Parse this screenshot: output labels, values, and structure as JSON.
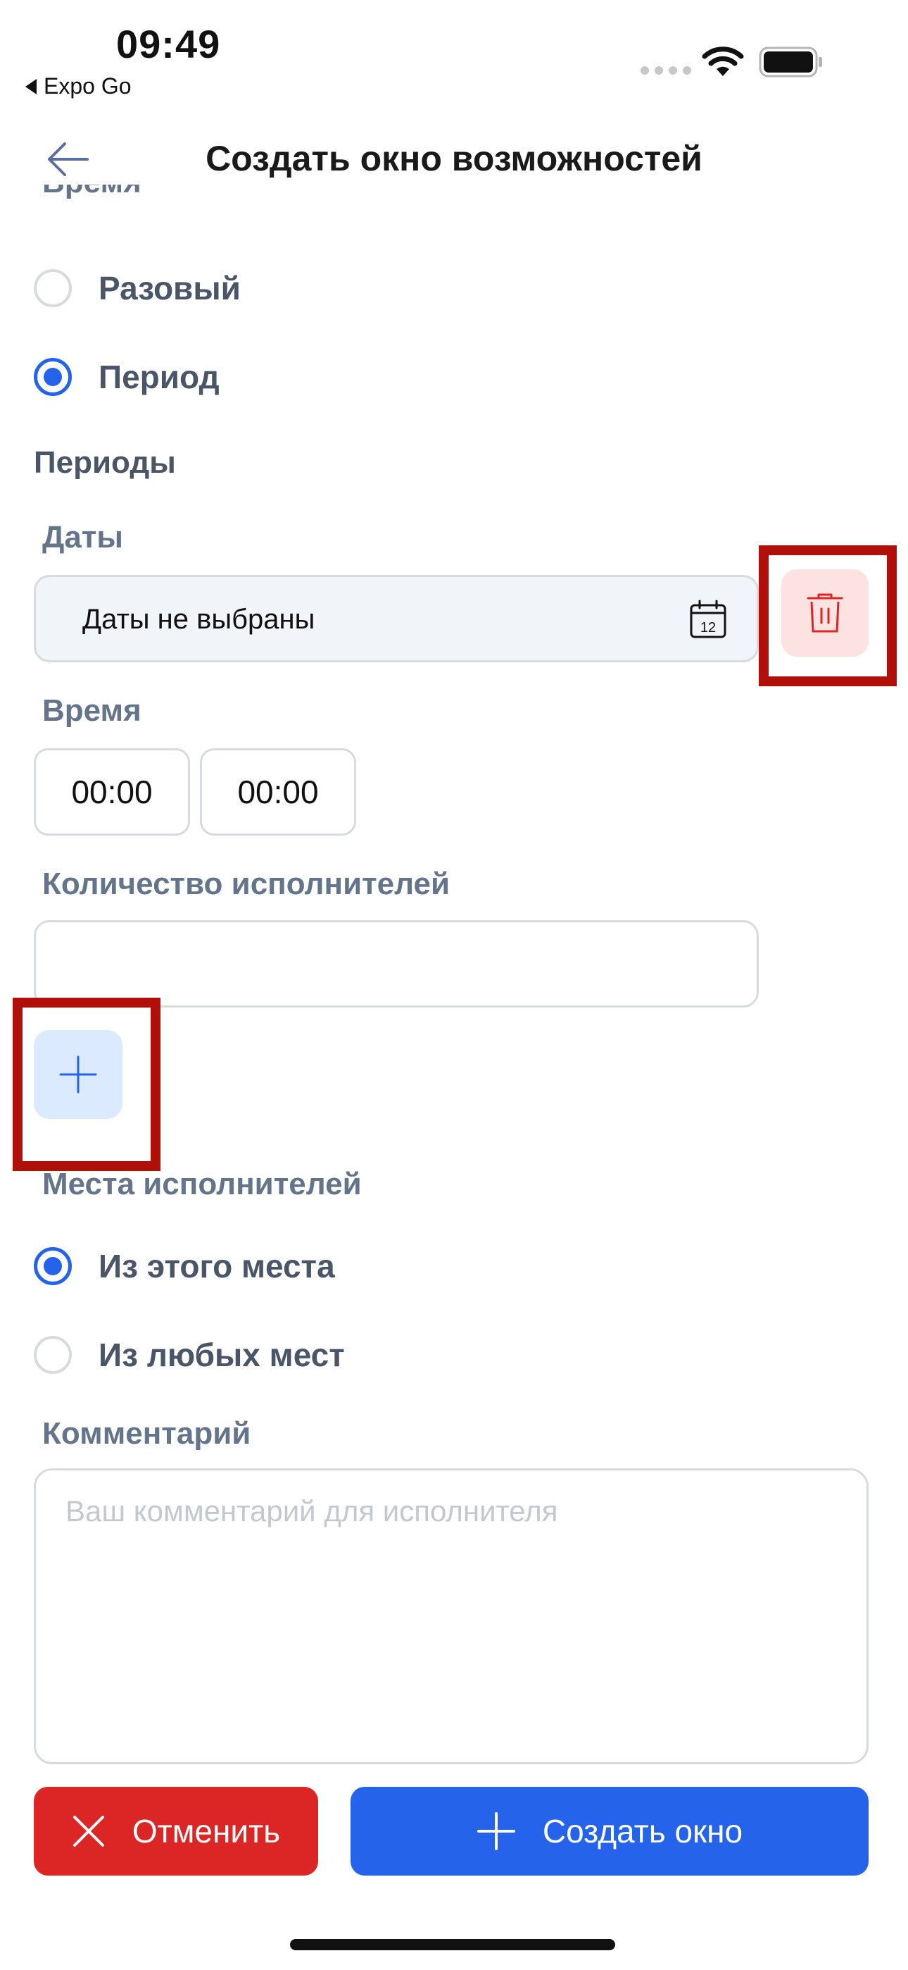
{
  "status_bar": {
    "time": "09:49",
    "back_app": "Expo Go",
    "icons": [
      "cellular-dots-icon",
      "wifi-icon",
      "battery-icon"
    ]
  },
  "header": {
    "title": "Создать окно возможностей",
    "back_icon": "arrow-left-icon"
  },
  "time_type": {
    "label": "Время",
    "options": [
      {
        "label": "Разовый",
        "checked": false
      },
      {
        "label": "Период",
        "checked": true
      }
    ]
  },
  "periods": {
    "title": "Периоды",
    "dates_label": "Даты",
    "dates_value": "Даты не выбраны",
    "calendar_icon_text": "12",
    "time_label": "Время",
    "time_from": "00:00",
    "time_to": "00:00",
    "count_label": "Количество исполнителей",
    "count_value": ""
  },
  "places": {
    "label": "Места исполнителей",
    "options": [
      {
        "label": "Из этого места",
        "checked": true
      },
      {
        "label": "Из любых мест",
        "checked": false
      }
    ]
  },
  "comment": {
    "label": "Комментарий",
    "placeholder": "Ваш комментарий для исполнителя"
  },
  "actions": {
    "cancel": "Отменить",
    "create": "Создать окно"
  },
  "colors": {
    "primary": "#2563eb",
    "danger": "#dc2626",
    "highlight": "#b00f0a",
    "label": "#64748b"
  }
}
